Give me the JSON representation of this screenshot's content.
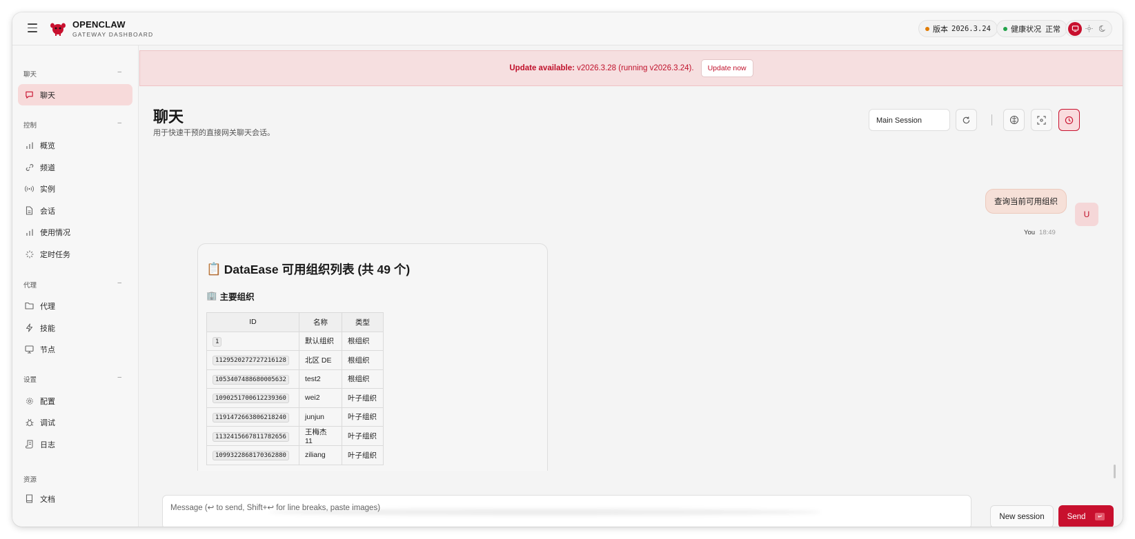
{
  "colors": {
    "accent": "#c8102e",
    "status_ok": "#22a34a",
    "status_warn": "#e07b00"
  },
  "app": {
    "title": "OPENCLAW",
    "subtitle": "GATEWAY DASHBOARD"
  },
  "header": {
    "version_label": "版本",
    "version_value": "2026.3.24",
    "health_label": "健康状况",
    "health_value": "正常",
    "theme_icons": [
      "monitor-icon",
      "sun-icon",
      "moon-icon"
    ]
  },
  "sidebar": {
    "groups": [
      {
        "label": "聊天",
        "items": [
          {
            "label": "聊天",
            "icon": "chat-icon",
            "active": true
          }
        ]
      },
      {
        "label": "控制",
        "items": [
          {
            "label": "概览",
            "icon": "bar-chart-icon"
          },
          {
            "label": "频道",
            "icon": "link-icon"
          },
          {
            "label": "实例",
            "icon": "broadcast-icon"
          },
          {
            "label": "会话",
            "icon": "file-icon"
          },
          {
            "label": "使用情况",
            "icon": "bar-chart-icon"
          },
          {
            "label": "定时任务",
            "icon": "loader-icon"
          }
        ]
      },
      {
        "label": "代理",
        "items": [
          {
            "label": "代理",
            "icon": "folder-icon"
          },
          {
            "label": "技能",
            "icon": "bolt-icon"
          },
          {
            "label": "节点",
            "icon": "monitor-icon"
          }
        ]
      },
      {
        "label": "设置",
        "items": [
          {
            "label": "配置",
            "icon": "gear-icon"
          },
          {
            "label": "调试",
            "icon": "bug-icon"
          },
          {
            "label": "日志",
            "icon": "scroll-icon"
          }
        ]
      },
      {
        "label": "资源",
        "items": [
          {
            "label": "文档",
            "icon": "book-icon"
          }
        ]
      }
    ]
  },
  "banner": {
    "prefix": "Update available:",
    "text": " v2026.3.28 (running v2026.3.24).",
    "button": "Update now"
  },
  "page": {
    "title": "聊天",
    "subtitle": "用于快速干预的直接网关聊天会话。",
    "session_select": "Main Session"
  },
  "chat": {
    "user_message": "查询当前可用组织",
    "user_avatar": "U",
    "user_name": "You",
    "user_time": "18:49",
    "bot": {
      "heading_emoji": "📋",
      "heading": "DataEase 可用组织列表 (共 49 个)",
      "subheading_emoji": "🏢",
      "subheading": "主要组织",
      "table": {
        "headers": [
          "ID",
          "名称",
          "类型"
        ],
        "rows": [
          [
            "1",
            "默认组织",
            "根组织"
          ],
          [
            "1129520272727216128",
            "北区 DE",
            "根组织"
          ],
          [
            "1053407488680005632",
            "test2",
            "根组织"
          ],
          [
            "1090251700612239360",
            "wei2",
            "叶子组织"
          ],
          [
            "1191472663806218240",
            "junjun",
            "叶子组织"
          ],
          [
            "1132415667811782656",
            "王梅杰 11",
            "叶子组织"
          ],
          [
            "1099322868170362880",
            "ziliang",
            "叶子组织"
          ]
        ]
      }
    }
  },
  "composer": {
    "placeholder": "Message (↩ to send, Shift+↩ for line breaks, paste images)",
    "new_session": "New session",
    "send": "Send",
    "send_kbd": "↵"
  }
}
